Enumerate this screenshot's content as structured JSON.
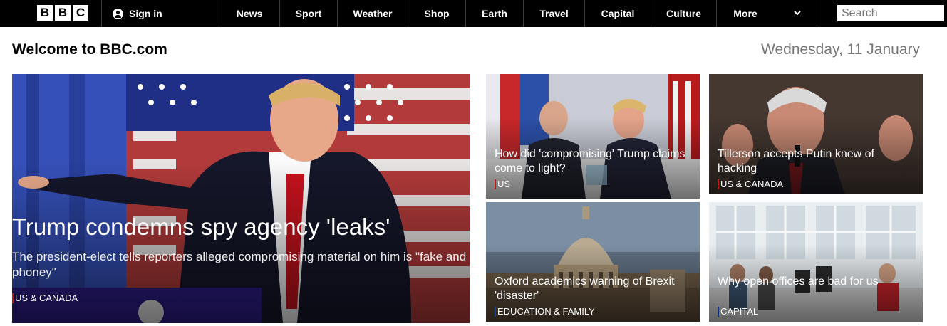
{
  "brand": {
    "letters": [
      "B",
      "B",
      "C"
    ]
  },
  "nav": {
    "signin_label": "Sign in",
    "items": [
      "News",
      "Sport",
      "Weather",
      "Shop",
      "Earth",
      "Travel",
      "Capital",
      "Culture",
      "More"
    ],
    "search_placeholder": "Search"
  },
  "page": {
    "welcome": "Welcome to BBC.com",
    "date": "Wednesday, 11 January"
  },
  "stories": {
    "lead": {
      "headline": "Trump condemns spy agency 'leaks'",
      "summary": "The president-elect tells reporters alleged compromising material on him is \"fake and phoney\"",
      "tag": "US & CANADA"
    },
    "s1": {
      "headline": "How did 'compromising' Trump claims come to light?",
      "tag": "US"
    },
    "s2": {
      "headline": "Tillerson accepts Putin knew of hacking",
      "tag": "US & CANADA"
    },
    "s3": {
      "headline": "Oxford academics warning of Brexit 'disaster'",
      "tag": "EDUCATION & FAMILY"
    },
    "s4": {
      "headline": "Why open offices are bad for us",
      "tag": "CAPITAL"
    }
  },
  "colors": {
    "news_tag": "#bb1919",
    "capital_tag": "#0a2d7a",
    "education_tag": "#1d3b8c"
  }
}
